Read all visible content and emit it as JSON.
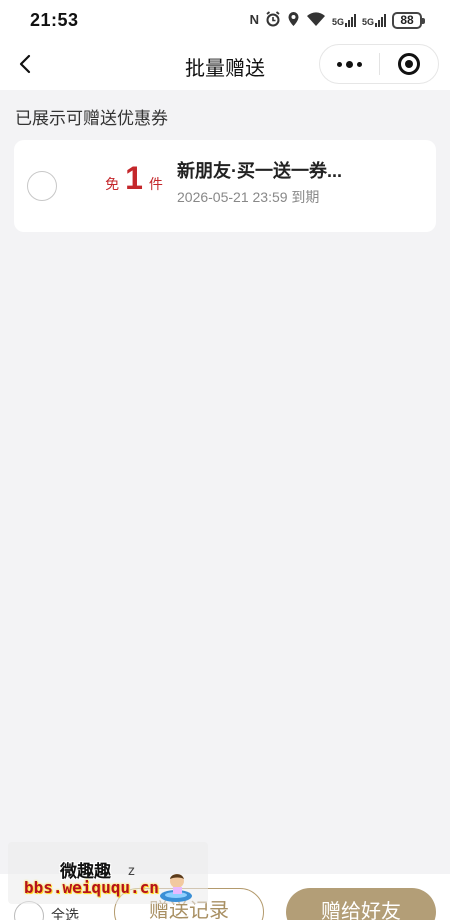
{
  "status_bar": {
    "time": "21:53",
    "nfc_icon": "N",
    "alarm_icon": "alarm-icon",
    "location_icon": "location-icon",
    "wifi_icon": "wifi-icon",
    "signal_1_label": "5G",
    "signal_2_label": "5G",
    "battery": "88"
  },
  "nav": {
    "title": "批量赠送",
    "back_icon": "chevron-left-icon",
    "more_icon": "more-icon",
    "close_icon": "target-icon"
  },
  "section_label": "已展示可赠送优惠券",
  "coupons": [
    {
      "badge_prefix": "免",
      "badge_number": "1",
      "badge_suffix": "件",
      "name": "新朋友·买一送一券...",
      "expiry": "2026-05-21 23:59 到期",
      "selected": false
    }
  ],
  "footer": {
    "select_all_label": "全选",
    "records_button": "赠送记录",
    "gift_button": "赠给好友"
  },
  "watermark": {
    "site_name": "微趣趣",
    "url": "bbs.weiququ.cn",
    "mark": "z"
  },
  "colors": {
    "accent_gold": "#b39e77",
    "badge_red": "#c4272b",
    "page_bg": "#f3f3f5"
  }
}
